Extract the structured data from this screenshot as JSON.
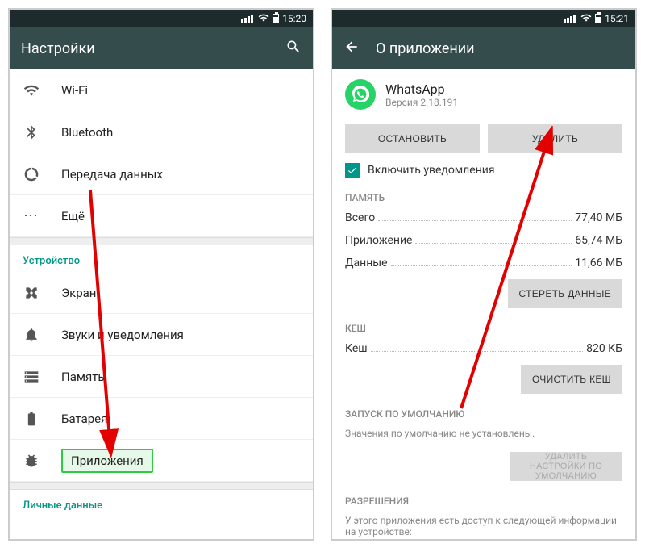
{
  "status": {
    "time_left": "15:20",
    "time_right": "15:21"
  },
  "left": {
    "title": "Настройки",
    "items": {
      "wifi": "Wi-Fi",
      "bluetooth": "Bluetooth",
      "data": "Передача данных",
      "more": "Ещё"
    },
    "sections": {
      "device": "Устройство",
      "personal": "Личные данные"
    },
    "device_items": {
      "display": "Экран",
      "sound": "Звуки и уведомления",
      "storage": "Память",
      "battery": "Батарея",
      "apps": "Приложения"
    }
  },
  "right": {
    "title": "О приложении",
    "app_name": "WhatsApp",
    "app_version": "Версия 2.18.191",
    "btn_stop": "ОСТАНОВИТЬ",
    "btn_uninstall": "УДАЛИТЬ",
    "checkbox_label": "Включить уведомления",
    "sections": {
      "memory": "ПАМЯТЬ",
      "cache": "КЕШ",
      "launch": "ЗАПУСК ПО УМОЛЧАНИЮ",
      "permissions": "РАЗРЕШЕНИЯ"
    },
    "memory": {
      "total_label": "Всего",
      "total_value": "77,40 МБ",
      "app_label": "Приложение",
      "app_value": "65,74 МБ",
      "data_label": "Данные",
      "data_value": "11,66 МБ",
      "clear_data": "СТЕРЕТЬ ДАННЫЕ"
    },
    "cache": {
      "cache_label": "Кеш",
      "cache_value": "820 КБ",
      "clear_cache": "ОЧИСТИТЬ КЕШ"
    },
    "launch_note": "Значения по умолчанию не установлены.",
    "btn_clear_defaults": "УДАЛИТЬ НАСТРОЙКИ ПО УМОЛЧАНИЮ",
    "perm_note": "У этого приложения есть доступ к следующей информации на устройстве:"
  }
}
